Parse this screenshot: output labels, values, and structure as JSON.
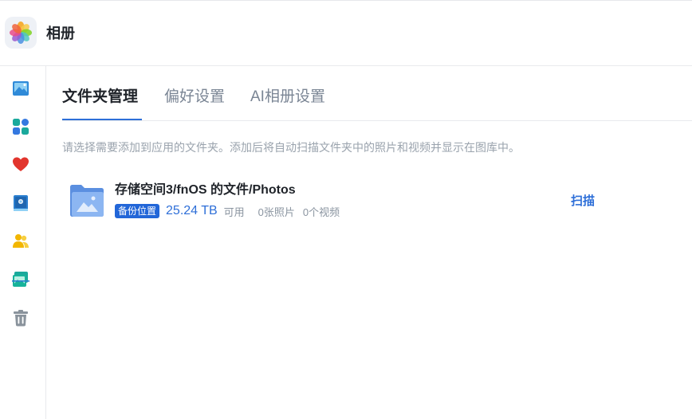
{
  "header": {
    "app_title": "相册",
    "app_icon": "photos-flower-icon"
  },
  "sidebar": {
    "items": [
      {
        "name": "sidebar-item-photos",
        "icon": "image-icon"
      },
      {
        "name": "sidebar-item-albums",
        "icon": "grid-icon"
      },
      {
        "name": "sidebar-item-favorites",
        "icon": "heart-icon"
      },
      {
        "name": "sidebar-item-album-book",
        "icon": "album-book-icon"
      },
      {
        "name": "sidebar-item-people",
        "icon": "people-icon"
      },
      {
        "name": "sidebar-item-shared",
        "icon": "shared-photos-icon"
      },
      {
        "name": "sidebar-item-trash",
        "icon": "trash-icon"
      }
    ]
  },
  "tabs": [
    {
      "label": "文件夹管理",
      "active": true
    },
    {
      "label": "偏好设置",
      "active": false
    },
    {
      "label": "AI相册设置",
      "active": false
    }
  ],
  "hint": "请选择需要添加到应用的文件夹。添加后将自动扫描文件夹中的照片和视频并显示在图库中。",
  "folders": [
    {
      "path": "存储空间3/fnOS 的文件/Photos",
      "badge": "备份位置",
      "capacity": "25.24 TB",
      "available_label": "可用",
      "photos": "0张照片",
      "videos": "0个视频",
      "action": "扫描"
    }
  ],
  "colors": {
    "accent": "#2e6fd8",
    "badge": "#2266d8",
    "muted_text": "#9aa3ad"
  }
}
